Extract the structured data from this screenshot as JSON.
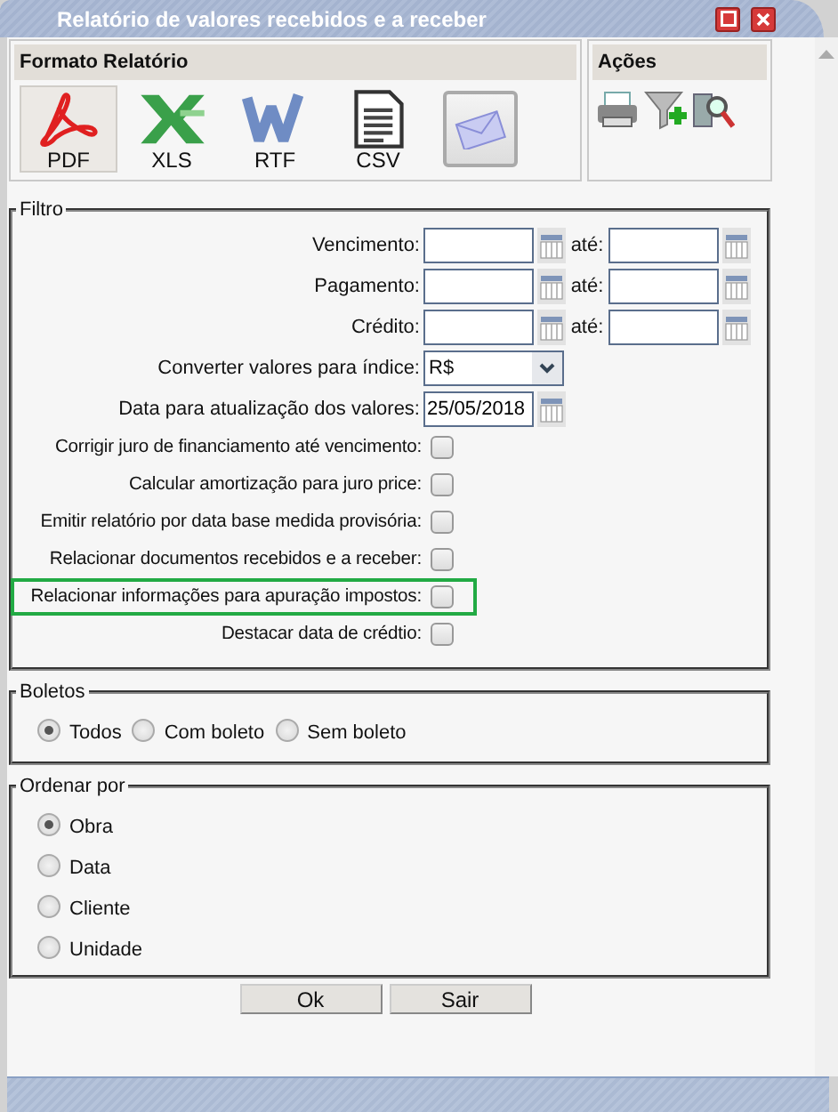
{
  "window": {
    "title": "Relatório de valores recebidos e a receber"
  },
  "format_panel": {
    "title": "Formato Relatório",
    "formats": [
      {
        "kind": "pdf",
        "label": "PDF",
        "selected": true
      },
      {
        "kind": "xls",
        "label": "XLS",
        "selected": false
      },
      {
        "kind": "rtf",
        "label": "RTF",
        "selected": false
      },
      {
        "kind": "csv",
        "label": "CSV",
        "selected": false
      },
      {
        "kind": "email",
        "selected": false
      }
    ]
  },
  "actions_panel": {
    "title": "Ações",
    "actions": [
      {
        "kind": "print"
      },
      {
        "kind": "filter"
      },
      {
        "kind": "search"
      }
    ]
  },
  "filter": {
    "legend": "Filtro",
    "date_ranges": [
      {
        "label": "Vencimento:",
        "to_label": "até:"
      },
      {
        "label": "Pagamento:",
        "to_label": "até:"
      },
      {
        "label": "Crédito:",
        "to_label": "até:"
      }
    ],
    "index_select": {
      "label": "Converter valores para índice:",
      "value": "R$"
    },
    "update_date": {
      "label": "Data para atualização dos valores:",
      "value": "25/05/2018"
    },
    "checks": [
      {
        "label": "Corrigir juro de financiamento até vencimento:",
        "checked": false,
        "highlighted": false
      },
      {
        "label": "Calcular amortização para juro price:",
        "checked": false,
        "highlighted": false
      },
      {
        "label": "Emitir relatório por data base medida provisória:",
        "checked": false,
        "highlighted": false
      },
      {
        "label": "Relacionar documentos recebidos e a receber:",
        "checked": false,
        "highlighted": false
      },
      {
        "label": "Relacionar informações para apuração impostos:",
        "checked": false,
        "highlighted": true
      },
      {
        "label": "Destacar data de crédtio:",
        "checked": false,
        "highlighted": false
      }
    ]
  },
  "boletos": {
    "legend": "Boletos",
    "options": [
      {
        "label": "Todos",
        "selected": true
      },
      {
        "label": "Com boleto",
        "selected": false
      },
      {
        "label": "Sem boleto",
        "selected": false
      }
    ]
  },
  "order_by": {
    "legend": "Ordenar por",
    "options": [
      {
        "label": "Obra",
        "selected": true
      },
      {
        "label": "Data",
        "selected": false
      },
      {
        "label": "Cliente",
        "selected": false
      },
      {
        "label": "Unidade",
        "selected": false
      }
    ]
  },
  "buttons": [
    "Ok",
    "Sair"
  ]
}
